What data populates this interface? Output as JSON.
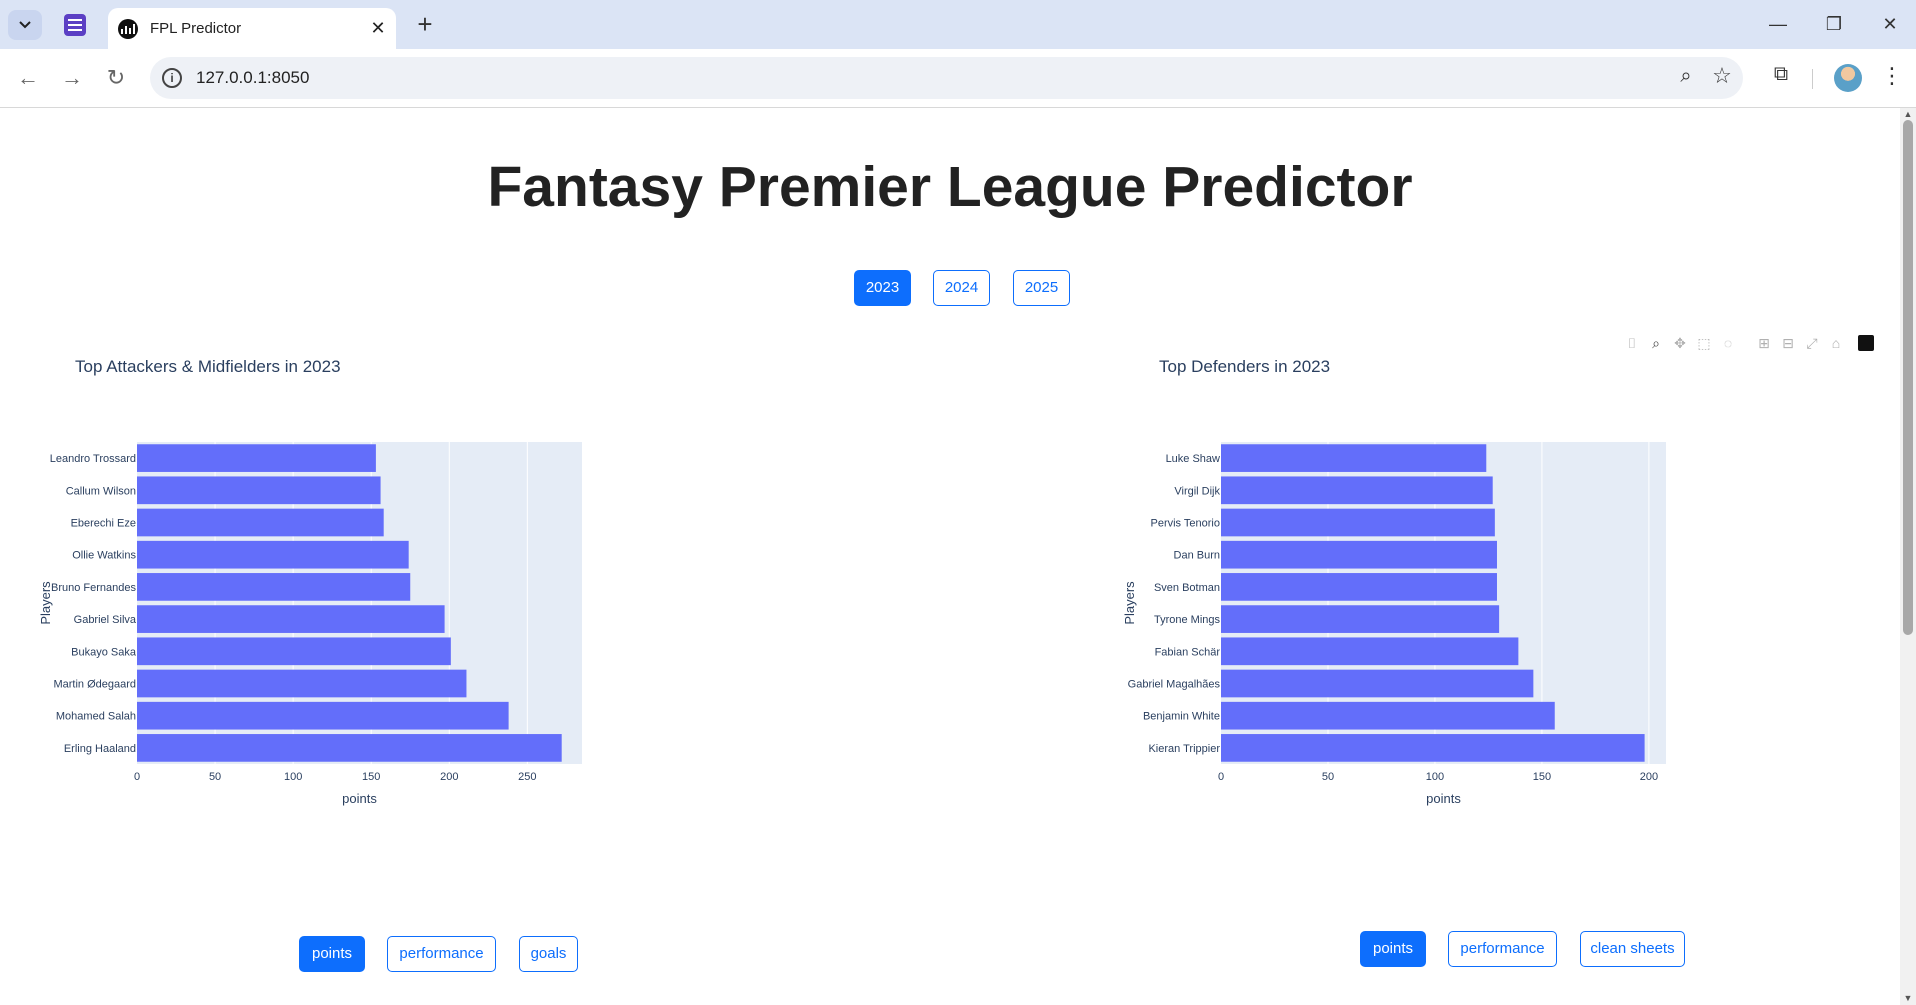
{
  "browser": {
    "tab_title": "FPL Predictor",
    "url": "127.0.0.1:8050",
    "icons": [
      "tab-search-icon",
      "tab-group-icon",
      "close-icon",
      "new-tab-icon",
      "minimize-icon",
      "restore-icon",
      "window-close-icon",
      "back-icon",
      "forward-icon",
      "reload-icon",
      "info-icon",
      "zoom-icon",
      "bookmark-star-icon",
      "extensions-icon",
      "profile-avatar",
      "kebab-menu-icon"
    ]
  },
  "page": {
    "title": "Fantasy Premier League Predictor",
    "years": [
      "2023",
      "2024",
      "2025"
    ],
    "active_year": "2023"
  },
  "left_chart": {
    "title": "Top Attackers & Midfielders in 2023",
    "metric_buttons": [
      "points",
      "performance",
      "goals"
    ],
    "active_metric": "points"
  },
  "right_chart": {
    "title": "Top Defenders in 2023",
    "metric_buttons": [
      "points",
      "performance",
      "clean sheets"
    ],
    "active_metric": "points"
  },
  "colors": {
    "bar": "#636efa",
    "plot_bg": "#e5ecf6",
    "accent": "#0d6efd"
  },
  "chart_data": [
    {
      "type": "bar",
      "orientation": "horizontal",
      "title": "Top Attackers & Midfielders in 2023",
      "xlabel": "points",
      "ylabel": "Players",
      "xlim": [
        0,
        285
      ],
      "xticks": [
        0,
        50,
        100,
        150,
        200,
        250
      ],
      "categories": [
        "Leandro Trossard",
        "Callum Wilson",
        "Eberechi Eze",
        "Ollie Watkins",
        "Bruno Fernandes",
        "Gabriel Silva",
        "Bukayo Saka",
        "Martin Ødegaard",
        "Mohamed Salah",
        "Erling Haaland"
      ],
      "values": [
        153,
        156,
        158,
        174,
        175,
        197,
        201,
        211,
        238,
        272
      ],
      "grid": true
    },
    {
      "type": "bar",
      "orientation": "horizontal",
      "title": "Top Defenders in 2023",
      "xlabel": "points",
      "ylabel": "Players",
      "xlim": [
        0,
        208
      ],
      "xticks": [
        0,
        50,
        100,
        150,
        200
      ],
      "categories": [
        "Luke Shaw",
        "Virgil Dijk",
        "Pervis Tenorio",
        "Dan Burn",
        "Sven Botman",
        "Tyrone Mings",
        "Fabian Schär",
        "Gabriel Magalhães",
        "Benjamin White",
        "Kieran Trippier"
      ],
      "values": [
        124,
        127,
        128,
        129,
        129,
        130,
        139,
        146,
        156,
        198
      ],
      "grid": true
    }
  ]
}
